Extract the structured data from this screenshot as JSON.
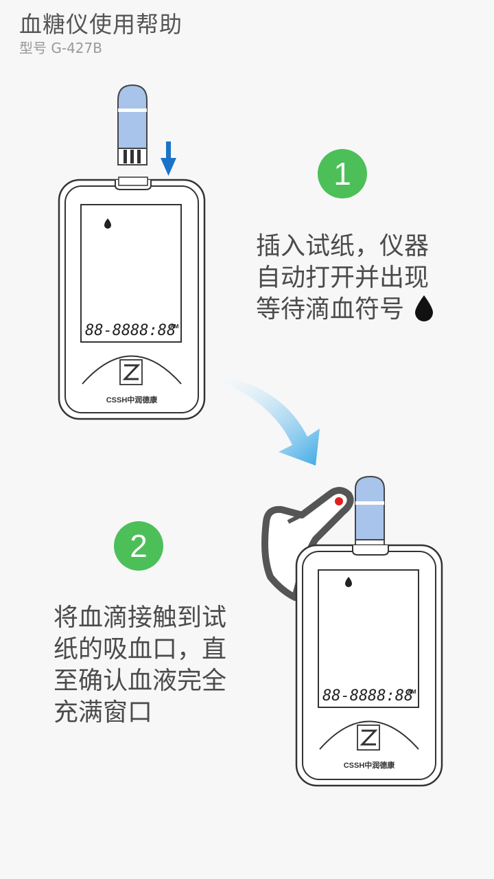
{
  "header": {
    "title": "血糖仪使用帮助",
    "model": "型号 G-427B"
  },
  "steps": [
    {
      "number": "1",
      "lines": [
        "插入试纸，仪器",
        "自动打开并出现",
        "等待滴血符号"
      ]
    },
    {
      "number": "2",
      "lines": [
        "将血滴接触到试",
        "纸的吸血口，直",
        "至确认血液完全",
        "充满窗口"
      ]
    }
  ],
  "device": {
    "display_date": "88-88",
    "display_time": "88:88",
    "display_ampm": "AM",
    "brand": "CSSH中润德康"
  },
  "colors": {
    "badge": "#4cbf59",
    "arrow_blue": "#1a73c8",
    "strip_blue": "#a9c4ea",
    "curve_arrow": "#3fa9e6",
    "blood": "#e02020"
  }
}
